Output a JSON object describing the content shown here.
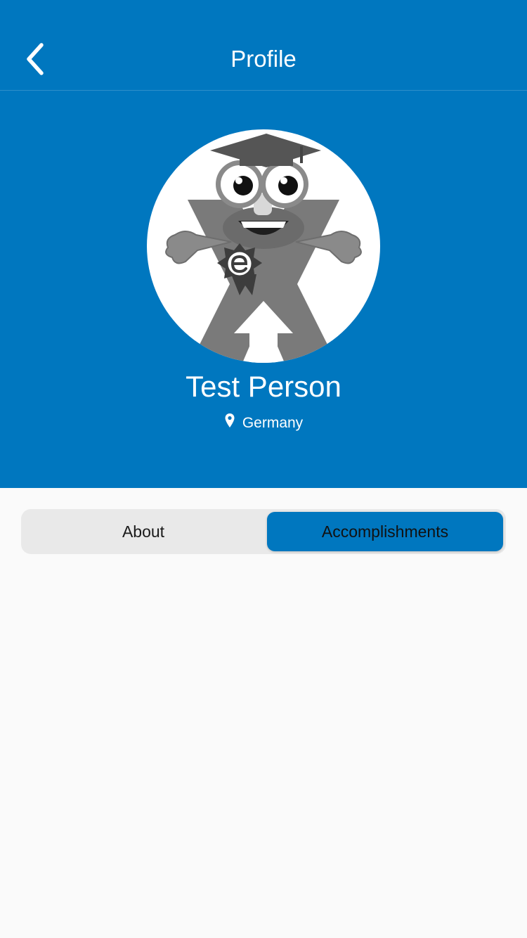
{
  "navbar": {
    "title": "Profile",
    "back_icon": "chevron-left-icon"
  },
  "profile": {
    "name": "Test Person",
    "location": "Germany",
    "location_icon": "map-pin-icon",
    "avatar": "mascot-avatar"
  },
  "tabs": [
    {
      "label": "About",
      "selected": false
    },
    {
      "label": "Accomplishments",
      "selected": true
    }
  ],
  "colors": {
    "header_bg": "#0077bf",
    "selected_tab_bg": "#0077bf",
    "page_bg": "#fafafa",
    "segment_bg": "#e9e9e9"
  }
}
